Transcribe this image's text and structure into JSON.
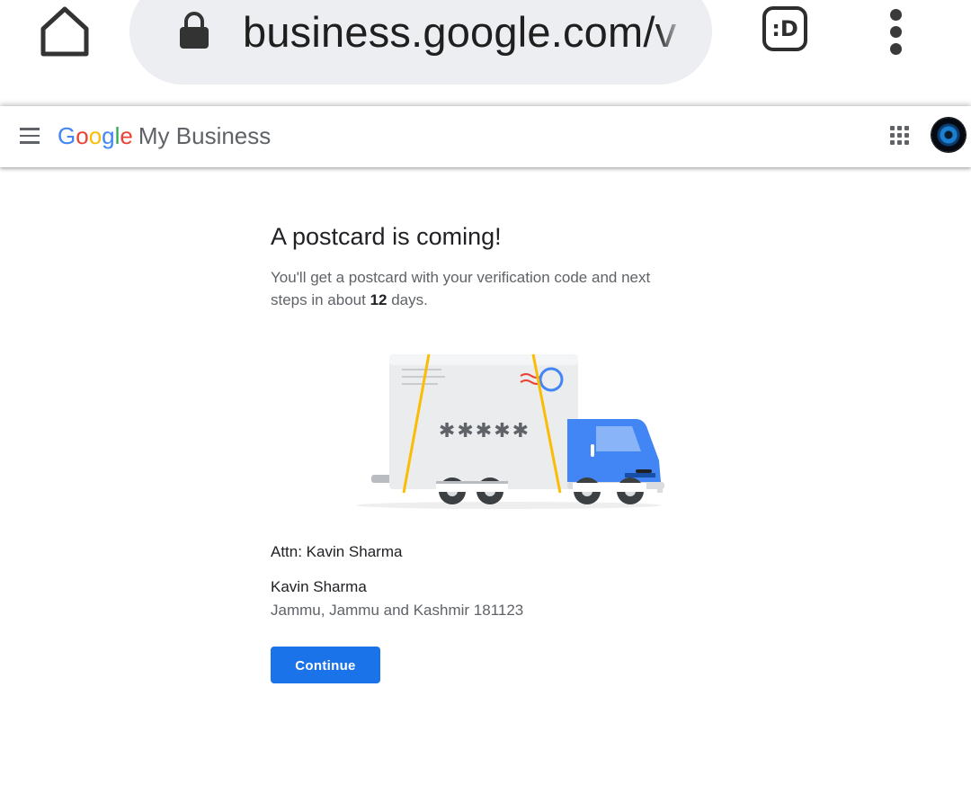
{
  "browser": {
    "url_display": "business.google.com/v",
    "extension_label": ":D"
  },
  "header": {
    "logo_letters": [
      "G",
      "o",
      "o",
      "g",
      "l",
      "e"
    ],
    "product_name": "My Business"
  },
  "main": {
    "title": "A postcard is coming!",
    "description_pre": "You'll get a postcard with your verification code and next steps in about ",
    "description_days": "12",
    "description_post": " days.",
    "code_placeholder": "✱✱✱✱✱",
    "attn": "Attn: Kavin Sharma",
    "address_name": "Kavin Sharma",
    "address_line": "Jammu, Jammu and Kashmir 181123",
    "continue_label": "Continue"
  },
  "colors": {
    "primary": "#1a73e8",
    "truck_blue": "#4285f4",
    "text_primary": "#202124",
    "text_secondary": "#5f6368"
  }
}
